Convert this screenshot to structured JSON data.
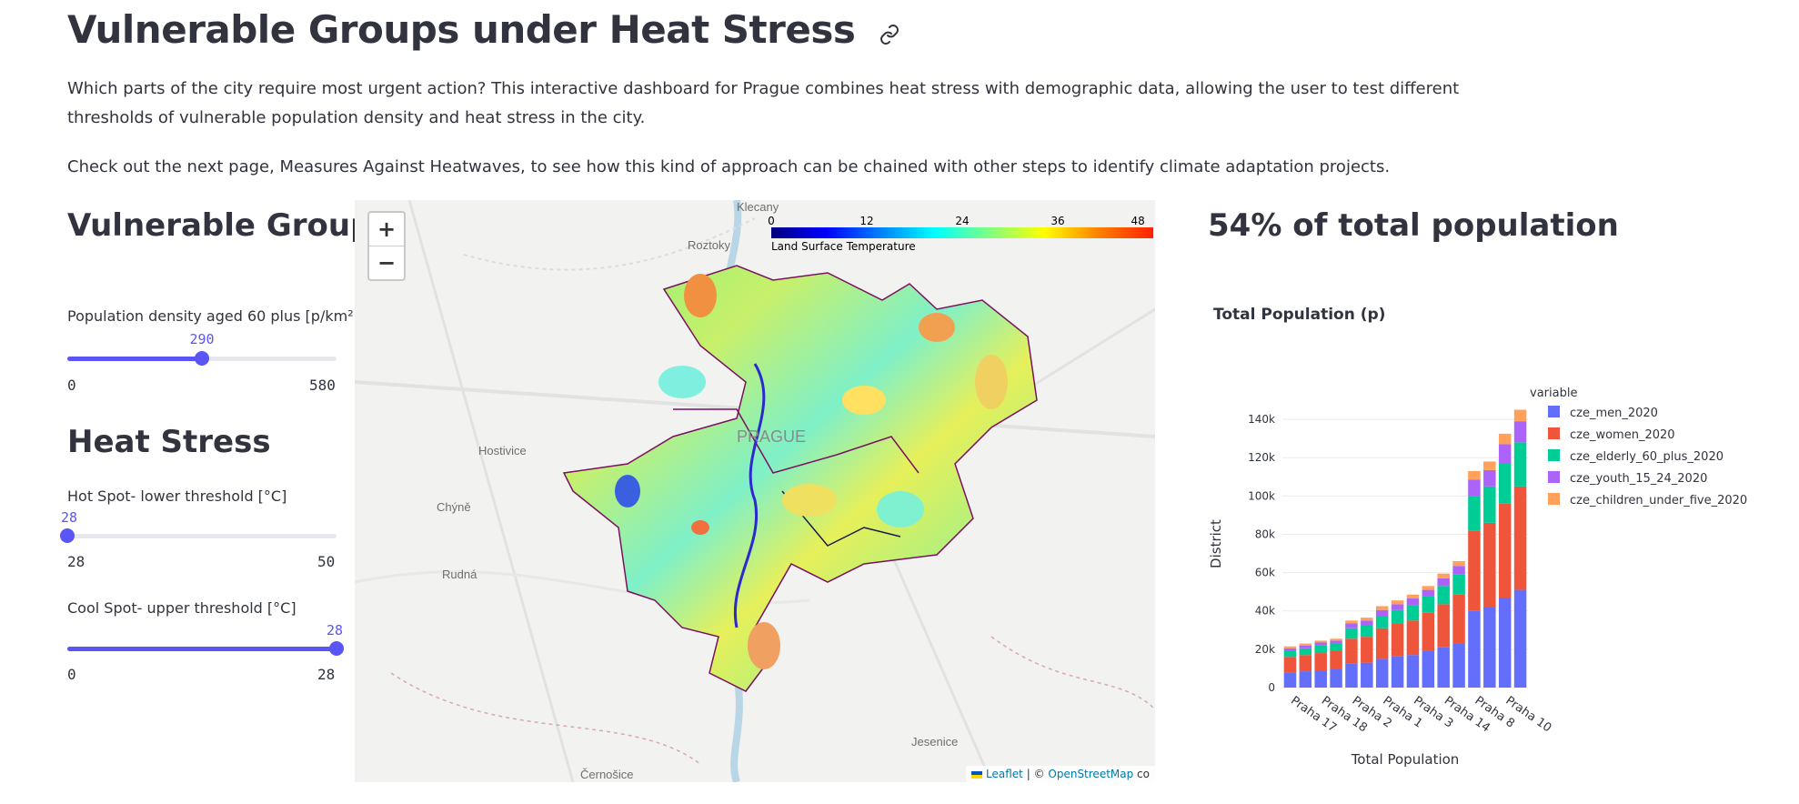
{
  "page": {
    "title": "Vulnerable Groups under Heat Stress",
    "intro": "Which parts of the city require most urgent action? This interactive dashboard for Prague combines heat stress with demographic data, allowing the user to test different thresholds of vulnerable population density and heat stress in the city.",
    "next_note": "Check out the next page, Measures Against Heatwaves, to see how this kind of approach can be chained with other steps to identify climate adaptation projects."
  },
  "sidebar": {
    "vulnerable_heading": "Vulnerable Groups",
    "heat_heading": "Heat Stress",
    "sliders": [
      {
        "label": "Population density aged 60 plus [p/km²]",
        "value": "290",
        "min": "0",
        "max": "580",
        "fraction": 0.5
      },
      {
        "label": "Hot Spot- lower threshold [°C]",
        "value": "28",
        "min": "28",
        "max": "50",
        "fraction": 0.0
      },
      {
        "label": "Cool Spot- upper threshold [°C]",
        "value": "28",
        "min": "0",
        "max": "28",
        "fraction": 1.0
      }
    ]
  },
  "map": {
    "zoom_in": "+",
    "zoom_out": "−",
    "legend": {
      "ticks": [
        "0",
        "12",
        "24",
        "36",
        "48"
      ],
      "caption": "Land Surface Temperature"
    },
    "places": [
      "Klecany",
      "Roztoky",
      "Hostivice",
      "Chýně",
      "Rudná",
      "Jesenice",
      "Černošice",
      "PRAGUE"
    ],
    "attribution": {
      "leaflet": "Leaflet",
      "sep": " | © ",
      "osm": "OpenStreetMap",
      "tail": " co"
    }
  },
  "results": {
    "headline": "54% of total population",
    "chart_title": "Total Population (p)"
  },
  "colors": {
    "accent": "#5a55f5",
    "men": "#636efa",
    "women": "#ef553b",
    "elderly": "#00cc96",
    "youth": "#ab63fa",
    "children": "#ffa15a"
  },
  "chart_data": {
    "type": "bar",
    "stacked": true,
    "title": "Total Population (p)",
    "xlabel": "Total Population",
    "ylabel": "District",
    "legend_title": "variable",
    "legend_position": "top-right",
    "ylim": [
      0,
      150000
    ],
    "yticks": [
      "0",
      "20k",
      "40k",
      "60k",
      "80k",
      "100k",
      "120k",
      "140k"
    ],
    "ytick_values": [
      0,
      20000,
      40000,
      60000,
      80000,
      100000,
      120000,
      140000
    ],
    "categories": [
      "Praha 17",
      "",
      "Praha 18",
      "",
      "Praha 2",
      "",
      "Praha 1",
      "",
      "Praha 3",
      "",
      "Praha 14",
      "",
      "Praha 8",
      "",
      "Praha 10"
    ],
    "series": [
      {
        "name": "cze_men_2020",
        "color": "#636efa",
        "values": [
          8000,
          8500,
          9000,
          9500,
          12500,
          13000,
          15000,
          16500,
          17000,
          19000,
          21000,
          23000,
          40000,
          42000,
          47000,
          51000
        ]
      },
      {
        "name": "cze_women_2020",
        "color": "#ef553b",
        "values": [
          8000,
          8500,
          9000,
          9500,
          13000,
          13500,
          16000,
          17000,
          18000,
          20000,
          22500,
          25500,
          42000,
          44000,
          49000,
          54000
        ]
      },
      {
        "name": "cze_elderly_60_plus_2020",
        "color": "#00cc96",
        "values": [
          3000,
          3500,
          4000,
          4000,
          5500,
          6000,
          6500,
          7000,
          8000,
          8500,
          9500,
          10500,
          18000,
          19000,
          21000,
          23000
        ]
      },
      {
        "name": "cze_youth_15_24_2020",
        "color": "#ab63fa",
        "values": [
          1500,
          1500,
          1500,
          1500,
          2500,
          2500,
          3000,
          3000,
          3500,
          3500,
          4000,
          4500,
          8500,
          8500,
          10000,
          11000
        ]
      },
      {
        "name": "cze_children_under_five_2020",
        "color": "#ffa15a",
        "values": [
          1000,
          1000,
          1000,
          1000,
          1500,
          1500,
          2000,
          2000,
          2000,
          2000,
          2500,
          2500,
          4500,
          4500,
          5500,
          6000
        ]
      }
    ]
  }
}
